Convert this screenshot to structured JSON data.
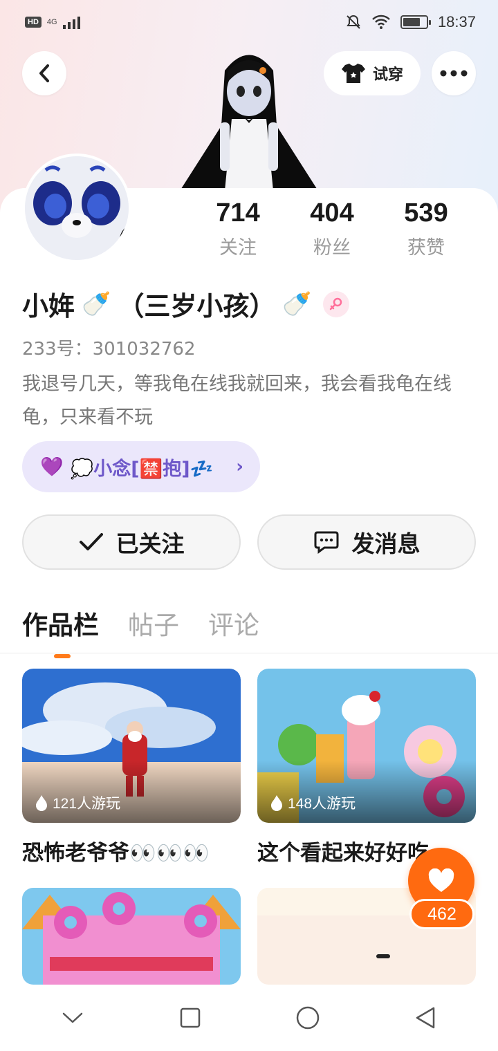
{
  "status_bar": {
    "hd": "HD",
    "network": "4G",
    "time": "18:37",
    "battery_level": 0.75
  },
  "header": {
    "try_on_label": "试穿"
  },
  "profile": {
    "stats": [
      {
        "value": "714",
        "label": "关注"
      },
      {
        "value": "404",
        "label": "粉丝"
      },
      {
        "value": "539",
        "label": "获赞"
      }
    ],
    "name_prefix": "小姩",
    "name_suffix": "（三岁小孩）",
    "bottle_emoji": "🍼",
    "uid": "233号：301032762",
    "bio": "我退号几天，等我龟在线我就回来，我会看我龟在线龟，只来看不玩",
    "crew_label": "💭小念[🈲抱]💤",
    "crew_heart": "💜"
  },
  "actions": {
    "follow_label": "已关注",
    "message_label": "发消息"
  },
  "tabs": [
    "作品栏",
    "帖子",
    "评论"
  ],
  "games": [
    {
      "plays": "121人游玩",
      "title": "恐怖老爷爷👀👀👀"
    },
    {
      "plays": "148人游玩",
      "title": "这个看起来好好吃"
    }
  ],
  "like_count": "462",
  "colors": {
    "accent": "#ff6a10",
    "crew_bg": "#ebe7fb",
    "crew_text": "#6e58c9"
  }
}
